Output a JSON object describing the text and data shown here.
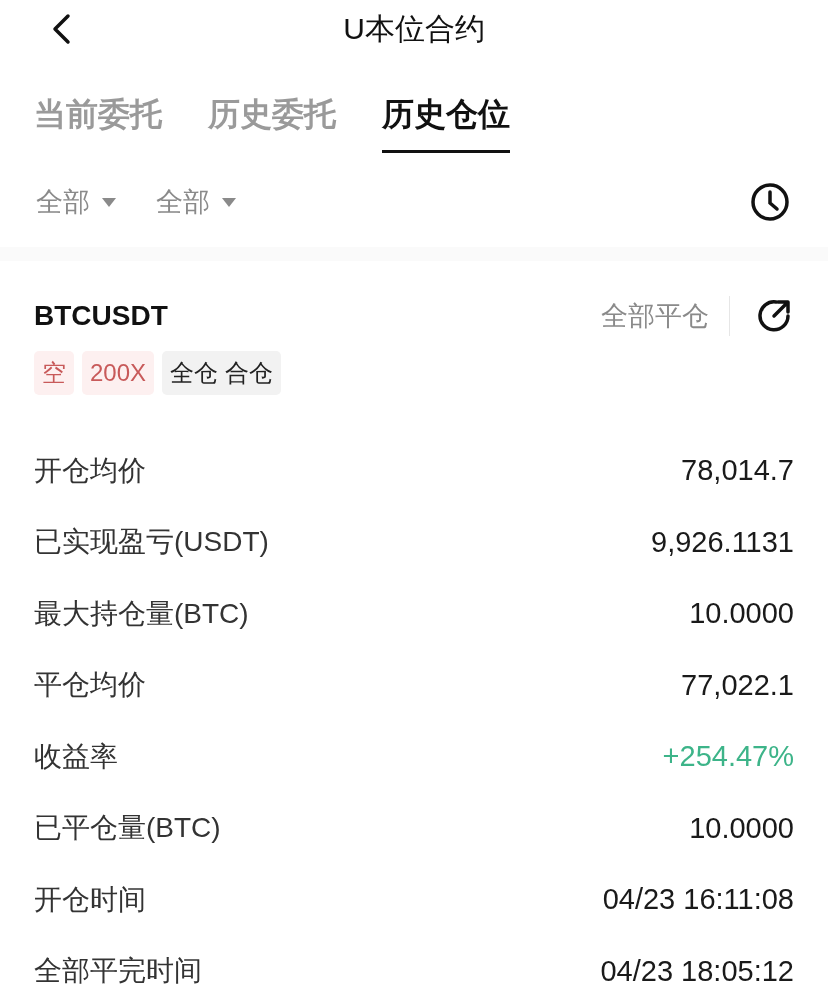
{
  "header": {
    "title": "U本位合约"
  },
  "tabs": [
    {
      "label": "当前委托",
      "selected": false
    },
    {
      "label": "历史委托",
      "selected": false
    },
    {
      "label": "历史仓位",
      "selected": true
    }
  ],
  "filters": [
    {
      "label": "全部"
    },
    {
      "label": "全部"
    }
  ],
  "position": {
    "symbol": "BTCUSDT",
    "close_all": "全部平仓",
    "tags": [
      {
        "label": "空",
        "kind": "short"
      },
      {
        "label": "200X",
        "kind": "short"
      },
      {
        "label": "全仓 合仓",
        "kind": "neutral"
      }
    ],
    "rows": [
      {
        "label": "开仓均价",
        "value": "78,014.7",
        "kind": "plain"
      },
      {
        "label": "已实现盈亏(USDT)",
        "value": "9,926.1131",
        "kind": "plain"
      },
      {
        "label": "最大持仓量(BTC)",
        "value": "10.0000",
        "kind": "plain"
      },
      {
        "label": "平仓均价",
        "value": "77,022.1",
        "kind": "plain"
      },
      {
        "label": "收益率",
        "value": "+254.47%",
        "kind": "gain"
      },
      {
        "label": "已平仓量(BTC)",
        "value": "10.0000",
        "kind": "plain"
      },
      {
        "label": "开仓时间",
        "value": "04/23 16:11:08",
        "kind": "plain"
      },
      {
        "label": "全部平完时间",
        "value": "04/23 18:05:12",
        "kind": "plain"
      }
    ]
  }
}
